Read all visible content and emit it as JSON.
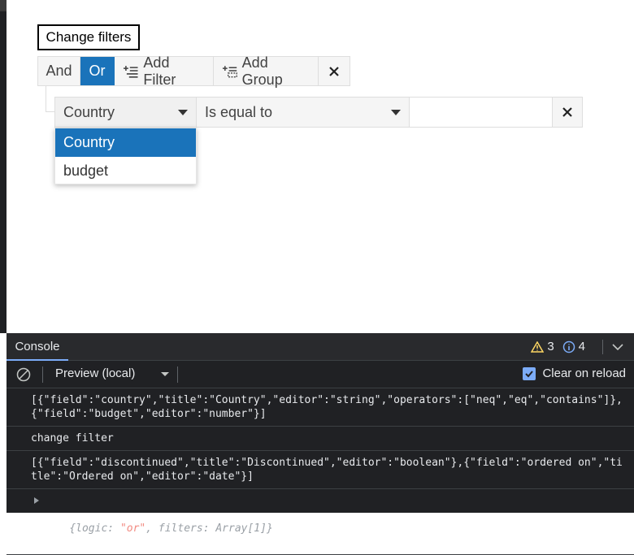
{
  "page": {
    "change_filters_label": "Change filters"
  },
  "filter_toolbar": {
    "and_label": "And",
    "or_label": "Or",
    "add_filter_label": "Add Filter",
    "add_group_label": "Add Group",
    "active_logic": "or"
  },
  "filter_row": {
    "field_value": "Country",
    "operator_value": "Is equal to",
    "value_input": ""
  },
  "field_dropdown": {
    "options": [
      "Country",
      "budget"
    ],
    "selected": "Country"
  },
  "console": {
    "tab_label": "Console",
    "warnings_count": "3",
    "info_count": "4",
    "context_label": "Preview (local)",
    "clear_on_reload_label": "Clear on reload",
    "messages": [
      "[{\"field\":\"country\",\"title\":\"Country\",\"editor\":\"string\",\"operators\":[\"neq\",\"eq\",\"contains\"]},{\"field\":\"budget\",\"editor\":\"number\"}]",
      "change filter",
      "[{\"field\":\"discontinued\",\"title\":\"Discontinued\",\"editor\":\"boolean\"},{\"field\":\"ordered on\",\"title\":\"Ordered on\",\"editor\":\"date\"}]"
    ],
    "object_prefix": "{logic: ",
    "object_logic": "\"or\"",
    "object_suffix": ", filters: Array[1]}"
  },
  "colors": {
    "accent": "#1a73ba",
    "console_bg": "#202124",
    "warning": "#fdd663",
    "info": "#7cacf8"
  }
}
